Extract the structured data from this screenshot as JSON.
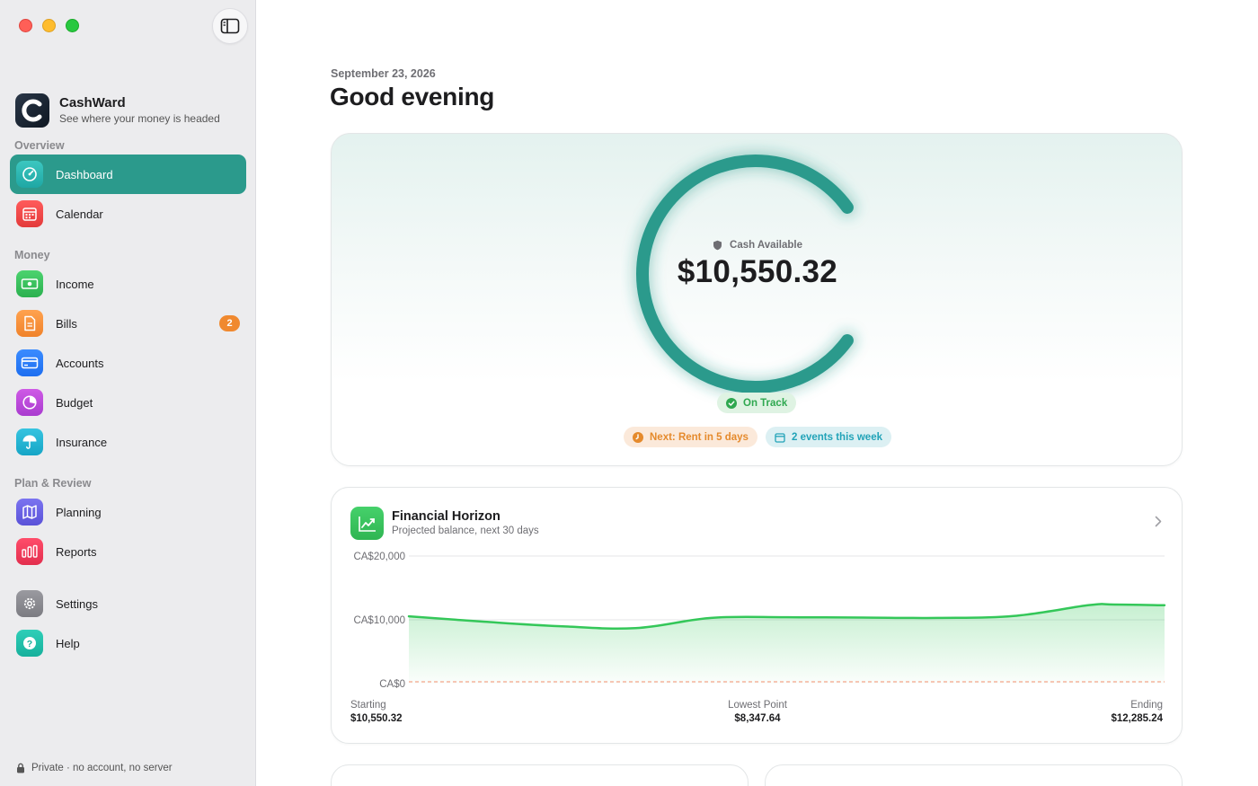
{
  "sidebar": {
    "brand_name": "CashWard",
    "brand_tagline": "See where your money is headed",
    "sections": {
      "overview": "Overview",
      "money": "Money",
      "plan": "Plan & Review"
    },
    "items": {
      "dashboard": "Dashboard",
      "calendar": "Calendar",
      "income": "Income",
      "bills": "Bills",
      "bills_badge": "2",
      "accounts": "Accounts",
      "budget": "Budget",
      "insurance": "Insurance",
      "planning": "Planning",
      "reports": "Reports",
      "settings": "Settings",
      "help": "Help"
    },
    "footer": "Private · no account, no server"
  },
  "header": {
    "date": "September 23, 2026",
    "greeting": "Good evening"
  },
  "hero": {
    "label": "Cash Available",
    "amount": "$10,550.32",
    "status": "On Track",
    "next": "Next: Rent in 5 days",
    "events": "2 events this week",
    "ring_fraction": 0.8
  },
  "horizon": {
    "title": "Financial Horizon",
    "subtitle": "Projected balance, next 30 days",
    "stats": {
      "starting_label": "Starting",
      "starting_value": "$10,550.32",
      "lowest_label": "Lowest Point",
      "lowest_value": "$8,347.64",
      "ending_label": "Ending",
      "ending_value": "$12,285.24"
    }
  },
  "chart_data": {
    "type": "area",
    "title": "Financial Horizon",
    "yticks": [
      "CA$20,000",
      "CA$10,000",
      "CA$0"
    ],
    "ylim": [
      0,
      20000
    ],
    "x": [
      0,
      3,
      6,
      9,
      12,
      15,
      18,
      21,
      24,
      27,
      28,
      30
    ],
    "values": [
      10550,
      9700,
      9000,
      8700,
      10300,
      10400,
      10350,
      10300,
      10600,
      12300,
      12400,
      12285
    ],
    "threshold_line": 0,
    "grid": true,
    "colors": {
      "line": "#34c759",
      "fill": "#34c759",
      "threshold": "#f4a58a"
    }
  },
  "colors": {
    "accent": "#2b9a8c",
    "ring": "#2b9a8c",
    "on_track": "#2fa850",
    "warning": "#e58a2c",
    "info": "#22a3b8",
    "badge": "#f0892f"
  }
}
